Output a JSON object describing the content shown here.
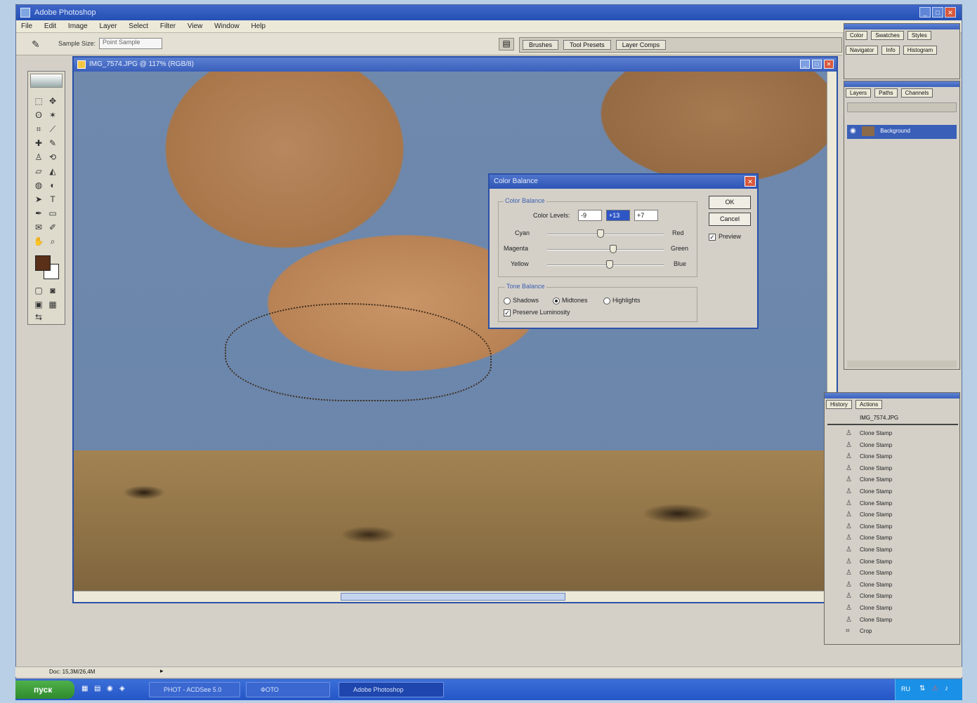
{
  "app": {
    "title": "Adobe Photoshop",
    "menu": [
      "File",
      "Edit",
      "Image",
      "Layer",
      "Select",
      "Filter",
      "View",
      "Window",
      "Help"
    ],
    "options_bar": {
      "label": "Sample Size:",
      "value": "Point Sample"
    },
    "palette_well_tabs": [
      "Brushes",
      "Tool Presets",
      "Layer Comps"
    ]
  },
  "document": {
    "title": "IMG_7574.JPG @ 117% (RGB/8)"
  },
  "dialog": {
    "title": "Color Balance",
    "color_balance_group": "Color Balance",
    "color_levels_label": "Color Levels:",
    "levels": [
      "-9",
      "+13",
      "+7"
    ],
    "sliders": [
      {
        "left": "Cyan",
        "right": "Red",
        "value": -9
      },
      {
        "left": "Magenta",
        "right": "Green",
        "value": 13
      },
      {
        "left": "Yellow",
        "right": "Blue",
        "value": 7
      }
    ],
    "tone_group": "Tone Balance",
    "tones": [
      "Shadows",
      "Midtones",
      "Highlights"
    ],
    "tone_selected": "Midtones",
    "preserve_luminosity": "Preserve Luminosity",
    "ok": "OK",
    "cancel": "Cancel",
    "preview": "Preview"
  },
  "panels": {
    "color_tabs": [
      "Color",
      "Swatches",
      "Styles"
    ],
    "navigator_tabs": [
      "Navigator",
      "Info",
      "Histogram"
    ],
    "layers_tabs": [
      "Layers",
      "Paths",
      "Channels"
    ],
    "layer_name": "Background",
    "history_tabs": [
      "History",
      "Actions"
    ],
    "history_snapshot": "IMG_7574.JPG",
    "history_items": [
      "Clone Stamp",
      "Clone Stamp",
      "Clone Stamp",
      "Clone Stamp",
      "Clone Stamp",
      "Clone Stamp",
      "Clone Stamp",
      "Clone Stamp",
      "Clone Stamp",
      "Clone Stamp",
      "Clone Stamp",
      "Clone Stamp",
      "Clone Stamp",
      "Clone Stamp",
      "Clone Stamp",
      "Clone Stamp",
      "Clone Stamp",
      "Crop"
    ]
  },
  "status": {
    "doc_size": "Doc: 15,3M/26,4M"
  },
  "taskbar": {
    "start": "пуск",
    "tasks": [
      "PHOT - ACDSee 5.0",
      "ФОТО",
      "Adobe Photoshop"
    ],
    "tray_text": "RU"
  }
}
